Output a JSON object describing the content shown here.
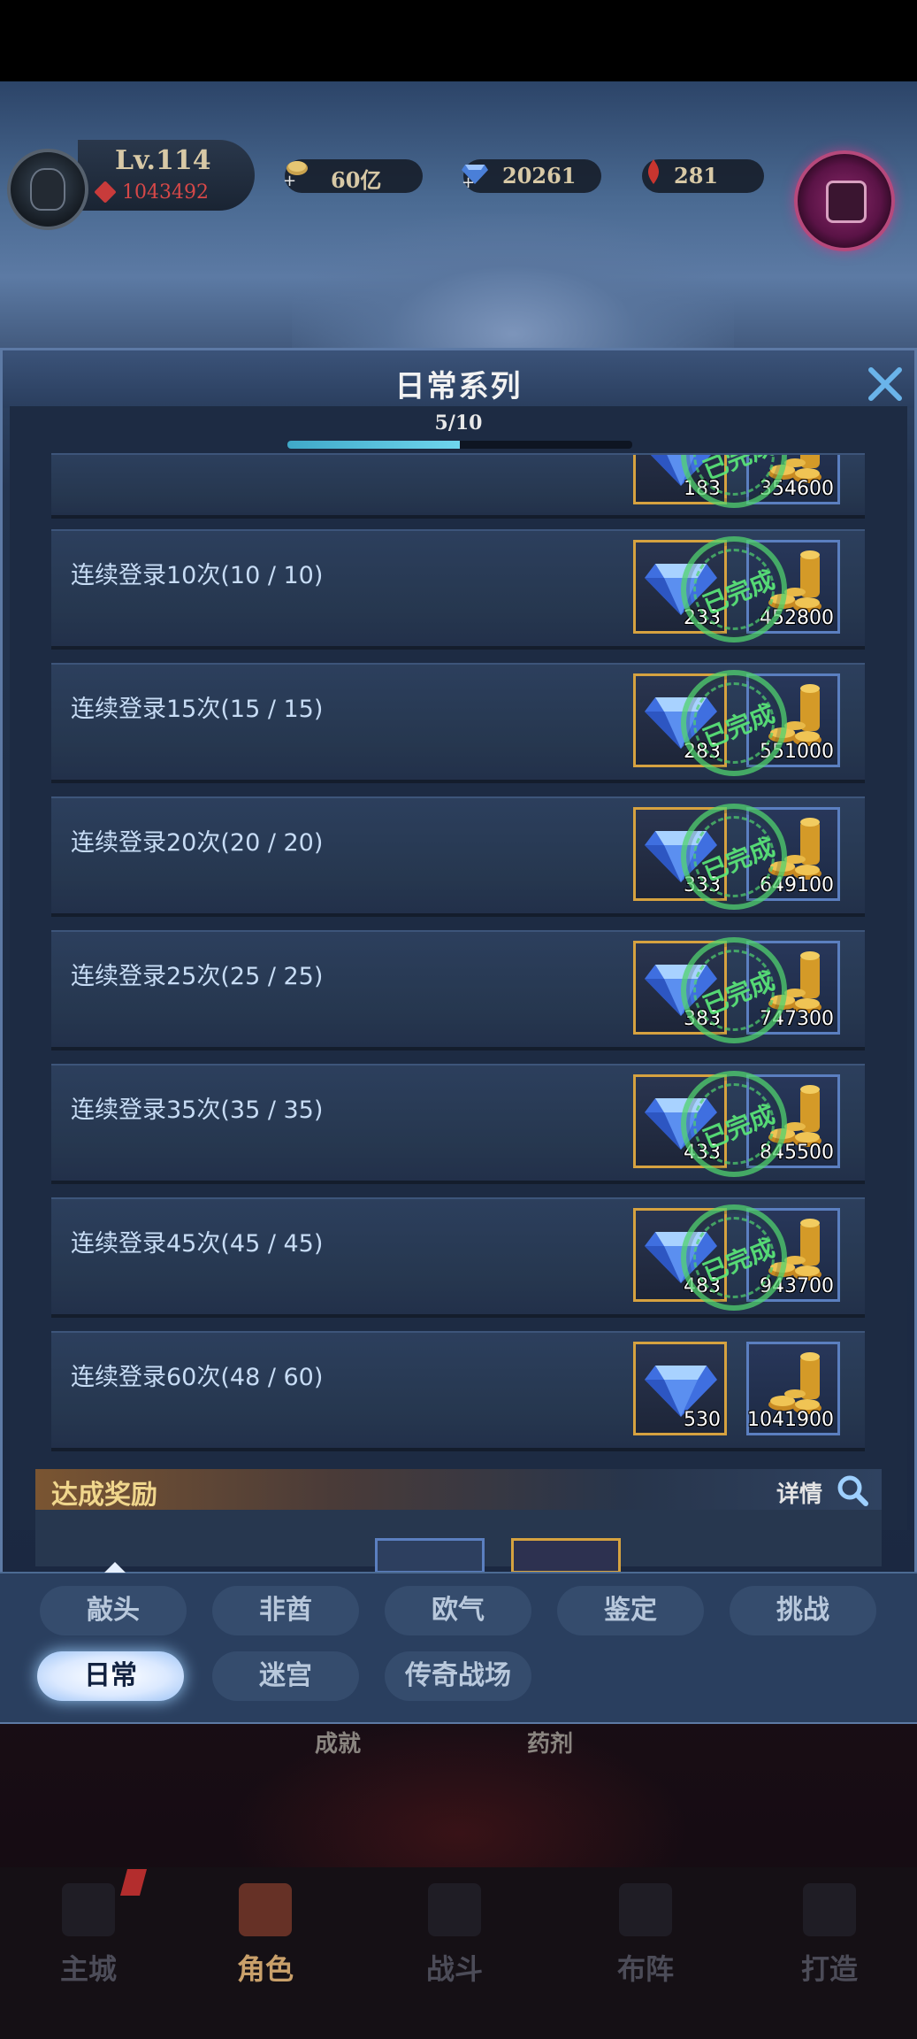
{
  "player": {
    "level": "Lv.114",
    "power": "1043492"
  },
  "resources": {
    "gold": "60亿",
    "gems": "20261",
    "ruby": "281"
  },
  "dialog": {
    "title": "日常系列",
    "progress_text": "5/10",
    "progress_fraction": 0.5
  },
  "quests": [
    {
      "label": "",
      "gem_qty": "183",
      "gold_qty": "354600",
      "completed": true,
      "stamp": "已完成"
    },
    {
      "label": "连续登录10次(10 / 10)",
      "gem_qty": "233",
      "gold_qty": "452800",
      "completed": true,
      "stamp": "已完成"
    },
    {
      "label": "连续登录15次(15 / 15)",
      "gem_qty": "283",
      "gold_qty": "551000",
      "completed": true,
      "stamp": "已完成"
    },
    {
      "label": "连续登录20次(20 / 20)",
      "gem_qty": "333",
      "gold_qty": "649100",
      "completed": true,
      "stamp": "已完成"
    },
    {
      "label": "连续登录25次(25 / 25)",
      "gem_qty": "383",
      "gold_qty": "747300",
      "completed": true,
      "stamp": "已完成"
    },
    {
      "label": "连续登录35次(35 / 35)",
      "gem_qty": "433",
      "gold_qty": "845500",
      "completed": true,
      "stamp": "已完成"
    },
    {
      "label": "连续登录45次(45 / 45)",
      "gem_qty": "483",
      "gold_qty": "943700",
      "completed": true,
      "stamp": "已完成"
    },
    {
      "label": "连续登录60次(48 / 60)",
      "gem_qty": "530",
      "gold_qty": "1041900",
      "completed": false,
      "stamp": ""
    }
  ],
  "achievement": {
    "title": "达成奖励",
    "detail_label": "详情"
  },
  "tabs": {
    "row1": [
      "敲头",
      "非酋",
      "欧气",
      "鉴定",
      "挑战"
    ],
    "row2": [
      "日常",
      "迷宫",
      "传奇战场"
    ],
    "active": "日常"
  },
  "background_labels": [
    "成就",
    "药剂"
  ],
  "bottom_nav": [
    "主城",
    "角色",
    "战斗",
    "布阵",
    "打造"
  ],
  "colors": {
    "accent_gold": "#d6a240",
    "stamp_green": "#5ae678",
    "title_text": "#f2f2f2"
  }
}
